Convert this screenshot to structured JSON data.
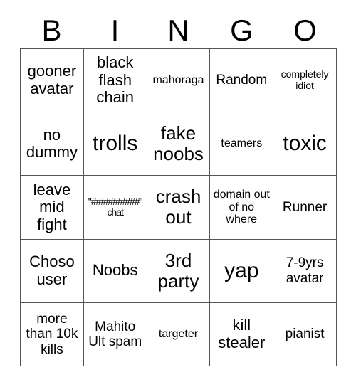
{
  "card": {
    "title": "BINGO",
    "headers": [
      "B",
      "I",
      "N",
      "G",
      "O"
    ],
    "grid_color": "#555555",
    "text_color": "#000000",
    "background_color": "#ffffff",
    "rows": [
      [
        {
          "text": "gooner avatar",
          "size": "fs-md"
        },
        {
          "text": "black flash chain",
          "size": "fs-md"
        },
        {
          "text": "mahoraga",
          "size": "fs-xs"
        },
        {
          "text": "Random",
          "size": "fs-sm"
        },
        {
          "text": "completely idiot",
          "size": "fs-xxs"
        }
      ],
      [
        {
          "text": "no dummy",
          "size": "fs-md"
        },
        {
          "text": "trolls",
          "size": "fs-xl"
        },
        {
          "text": "fake noobs",
          "size": "fs-lg"
        },
        {
          "text": "teamers",
          "size": "fs-xs"
        },
        {
          "text": "toxic",
          "size": "fs-xl"
        }
      ],
      [
        {
          "text": "leave mid fight",
          "size": "fs-md"
        },
        {
          "text": "\"##########\" chat",
          "size": "fs-xxs"
        },
        {
          "text": "crash out",
          "size": "fs-lg"
        },
        {
          "text": "domain out of no where",
          "size": "fs-xs"
        },
        {
          "text": "Runner",
          "size": "fs-sm"
        }
      ],
      [
        {
          "text": "Choso user",
          "size": "fs-md"
        },
        {
          "text": "Noobs",
          "size": "fs-md"
        },
        {
          "text": "3rd party",
          "size": "fs-lg"
        },
        {
          "text": "yap",
          "size": "fs-xl"
        },
        {
          "text": "7-9yrs avatar",
          "size": "fs-sm"
        }
      ],
      [
        {
          "text": "more than 10k kills",
          "size": "fs-sm"
        },
        {
          "text": "Mahito Ult spam",
          "size": "fs-sm"
        },
        {
          "text": "targeter",
          "size": "fs-xs"
        },
        {
          "text": "kill stealer",
          "size": "fs-md"
        },
        {
          "text": "pianist",
          "size": "fs-sm"
        }
      ]
    ]
  }
}
